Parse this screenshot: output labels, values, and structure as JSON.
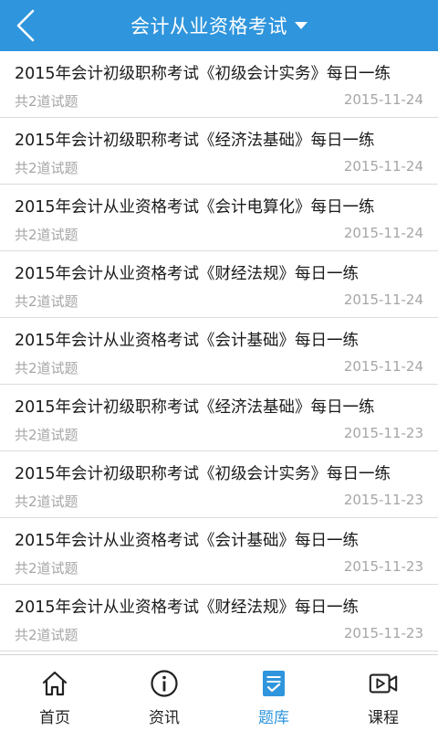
{
  "header": {
    "title": "会计从业资格考试",
    "back_icon": "chevron-left-icon",
    "dropdown_icon": "caret-down-icon",
    "bg_color": "#2f95dc"
  },
  "list": {
    "items": [
      {
        "title": "2015年会计初级职称考试《初级会计实务》每日一练",
        "count": "共2道试题",
        "date": "2015-11-24"
      },
      {
        "title": "2015年会计初级职称考试《经济法基础》每日一练",
        "count": "共2道试题",
        "date": "2015-11-24"
      },
      {
        "title": "2015年会计从业资格考试《会计电算化》每日一练",
        "count": "共2道试题",
        "date": "2015-11-24"
      },
      {
        "title": "2015年会计从业资格考试《财经法规》每日一练",
        "count": "共2道试题",
        "date": "2015-11-24"
      },
      {
        "title": "2015年会计从业资格考试《会计基础》每日一练",
        "count": "共2道试题",
        "date": "2015-11-24"
      },
      {
        "title": "2015年会计初级职称考试《经济法基础》每日一练",
        "count": "共2道试题",
        "date": "2015-11-23"
      },
      {
        "title": "2015年会计初级职称考试《初级会计实务》每日一练",
        "count": "共2道试题",
        "date": "2015-11-23"
      },
      {
        "title": "2015年会计从业资格考试《会计基础》每日一练",
        "count": "共2道试题",
        "date": "2015-11-23"
      },
      {
        "title": "2015年会计从业资格考试《财经法规》每日一练",
        "count": "共2道试题",
        "date": "2015-11-23"
      }
    ]
  },
  "bottom_nav": {
    "active_index": 2,
    "active_color": "#2f95dc",
    "items": [
      {
        "label": "首页",
        "icon": "home-icon"
      },
      {
        "label": "资讯",
        "icon": "info-icon"
      },
      {
        "label": "题库",
        "icon": "question-bank-icon"
      },
      {
        "label": "课程",
        "icon": "video-course-icon"
      }
    ]
  }
}
